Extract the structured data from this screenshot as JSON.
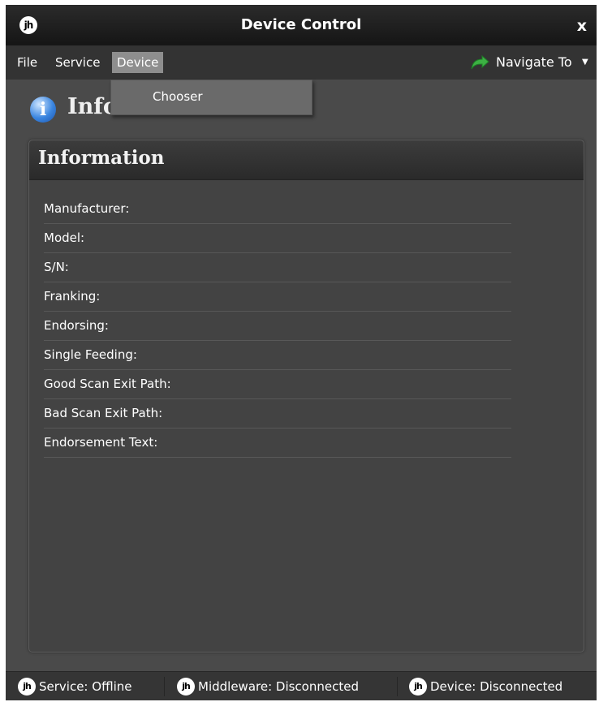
{
  "window": {
    "title": "Device Control",
    "close_label": "x",
    "logo_text": "jh"
  },
  "menu": {
    "items": [
      "File",
      "Service",
      "Device"
    ],
    "active": "Device",
    "navigate_label": "Navigate To",
    "navigate_caret": "▼"
  },
  "dropdown": {
    "items": [
      "Chooser"
    ]
  },
  "page": {
    "title": "Information",
    "info_icon_glyph": "i"
  },
  "panel": {
    "title": "Information",
    "fields": [
      "Manufacturer:",
      "Model:",
      "S/N:",
      "Franking:",
      "Endorsing:",
      "Single Feeding:",
      "Good Scan Exit Path:",
      "Bad Scan Exit Path:",
      "Endorsement Text:"
    ]
  },
  "status": {
    "logo_text": "jh",
    "service": "Service: Offline",
    "middleware": "Middleware: Disconnected",
    "device": "Device: Disconnected"
  },
  "colors": {
    "window_bg": "#4a4a4a",
    "titlebar": "#1c1c1c",
    "active_menu": "#8e8e8e",
    "navigate_arrow": "#3cb043",
    "info_icon": "#3b86e0"
  }
}
